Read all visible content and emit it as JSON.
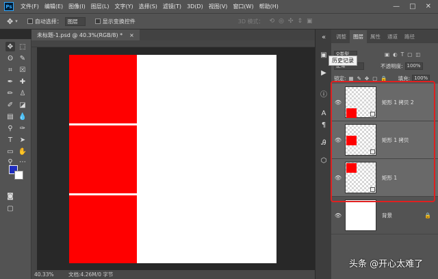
{
  "app": {
    "logo": "Ps"
  },
  "menu": [
    "文件(F)",
    "编辑(E)",
    "图像(I)",
    "图层(L)",
    "文字(Y)",
    "选择(S)",
    "滤镜(T)",
    "3D(D)",
    "视图(V)",
    "窗口(W)",
    "帮助(H)"
  ],
  "window_controls": [
    "—",
    "□",
    "✕"
  ],
  "options": {
    "auto_select_label": "自动选择：",
    "auto_select_value": "图层",
    "transform_label": "显示变换控件",
    "mode_3d_label": "3D 模式："
  },
  "document": {
    "tab_title": "未标题-1.psd @ 40.3%(RGB/8) *",
    "tab_close": "×",
    "zoom": "40.33%",
    "doc_info": "文档:4.26M/0 字节"
  },
  "colors": {
    "foreground": "#1f2dbd",
    "background": "#ffffff",
    "shape": "#ff0000",
    "highlight": "#e02020"
  },
  "panel": {
    "tabs": [
      "调整",
      "图层",
      "属性",
      "通道",
      "路径"
    ],
    "active_tab": "图层",
    "tooltip": "历史记录",
    "filter_label": "类型",
    "blend_mode": "正常",
    "opacity_label": "不透明度:",
    "opacity_value": "100%",
    "lock_label": "锁定:",
    "fill_label": "填充:",
    "fill_value": "100%"
  },
  "layers": [
    {
      "name": "矩形 1 拷贝 2",
      "selected": true
    },
    {
      "name": "矩形 1 拷贝",
      "selected": true
    },
    {
      "name": "矩形 1",
      "selected": true
    },
    {
      "name": "背景",
      "selected": false
    }
  ],
  "watermark": "头条 @开心太难了"
}
